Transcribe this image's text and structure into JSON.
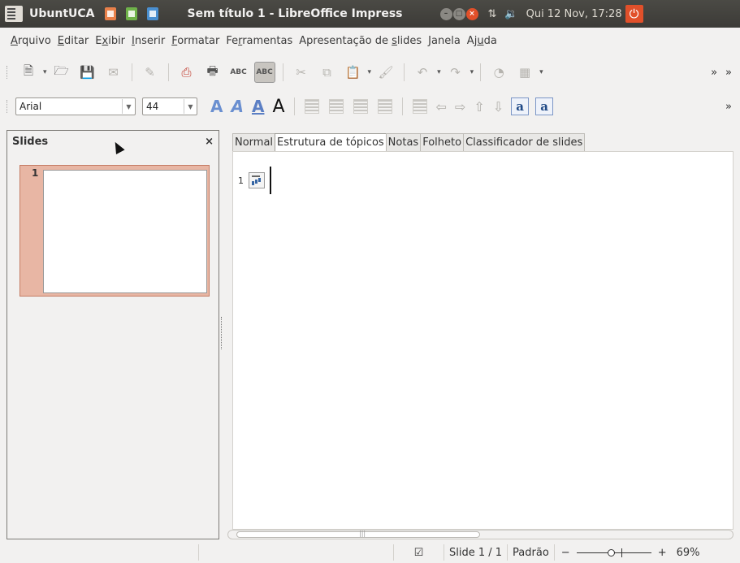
{
  "panel": {
    "distro": "UbuntUCA",
    "window_title": "Sem título 1 - LibreOffice Impress",
    "clock": "Qui 12 Nov, 17:28"
  },
  "menu": [
    {
      "pre": "",
      "u": "A",
      "post": "rquivo"
    },
    {
      "pre": "",
      "u": "E",
      "post": "ditar"
    },
    {
      "pre": "E",
      "u": "x",
      "post": "ibir"
    },
    {
      "pre": "",
      "u": "I",
      "post": "nserir"
    },
    {
      "pre": "",
      "u": "F",
      "post": "ormatar"
    },
    {
      "pre": "Fe",
      "u": "r",
      "post": "ramentas"
    },
    {
      "pre": "Apresentação de ",
      "u": "s",
      "post": "lides"
    },
    {
      "pre": "",
      "u": "J",
      "post": "anela"
    },
    {
      "pre": "Aj",
      "u": "u",
      "post": "da"
    }
  ],
  "format": {
    "font_name": "Arial",
    "font_size": "44"
  },
  "slides_pane": {
    "title": "Slides",
    "close": "×",
    "thumb_number": "1"
  },
  "tabs": [
    "Normal",
    "Estrutura de tópicos",
    "Notas",
    "Folheto",
    "Classificador de slides"
  ],
  "active_tab": "Estrutura de tópicos",
  "outline": {
    "number": "1"
  },
  "statusbar": {
    "slide": "Slide 1 / 1",
    "layout": "Padrão",
    "zoom_minus": "−",
    "zoom_plus": "+",
    "zoom_value": "69%"
  },
  "icons": {
    "overflow": "»"
  }
}
